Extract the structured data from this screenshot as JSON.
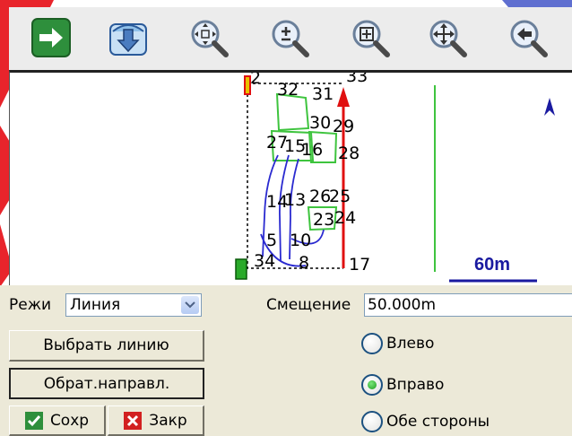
{
  "toolbar": {
    "buttons": [
      {
        "name": "apply-arrow-icon"
      },
      {
        "name": "download-layer-icon"
      },
      {
        "name": "zoom-center-icon"
      },
      {
        "name": "zoom-in-icon"
      },
      {
        "name": "zoom-window-icon"
      },
      {
        "name": "pan-icon"
      },
      {
        "name": "back-icon"
      }
    ]
  },
  "map": {
    "scale_label": "60m",
    "point_labels": {
      "p2": "2",
      "p32": "32",
      "p31": "31",
      "p33": "33",
      "p30": "30",
      "p29": "29",
      "p27": "27",
      "p15": "15",
      "p16": "16",
      "p28": "28",
      "p14": "14",
      "p13": "13",
      "p26": "26",
      "p25": "25",
      "p23": "23",
      "p24": "24",
      "p5": "5",
      "p10": "10",
      "p8": "8",
      "p17": "17",
      "p34": "34"
    }
  },
  "panel": {
    "mode_label": "Режи",
    "mode_value": "Линия",
    "offset_label": "Смещение",
    "offset_value": "50.000m",
    "select_line_button": "Выбрать линию",
    "reverse_button": "Обрат.направл.",
    "save_button": "Сохр",
    "close_button": "Закр",
    "radio_left": "Влево",
    "radio_right": "Вправо",
    "radio_both": "Обе стороны",
    "selected_side": "Вправо"
  }
}
